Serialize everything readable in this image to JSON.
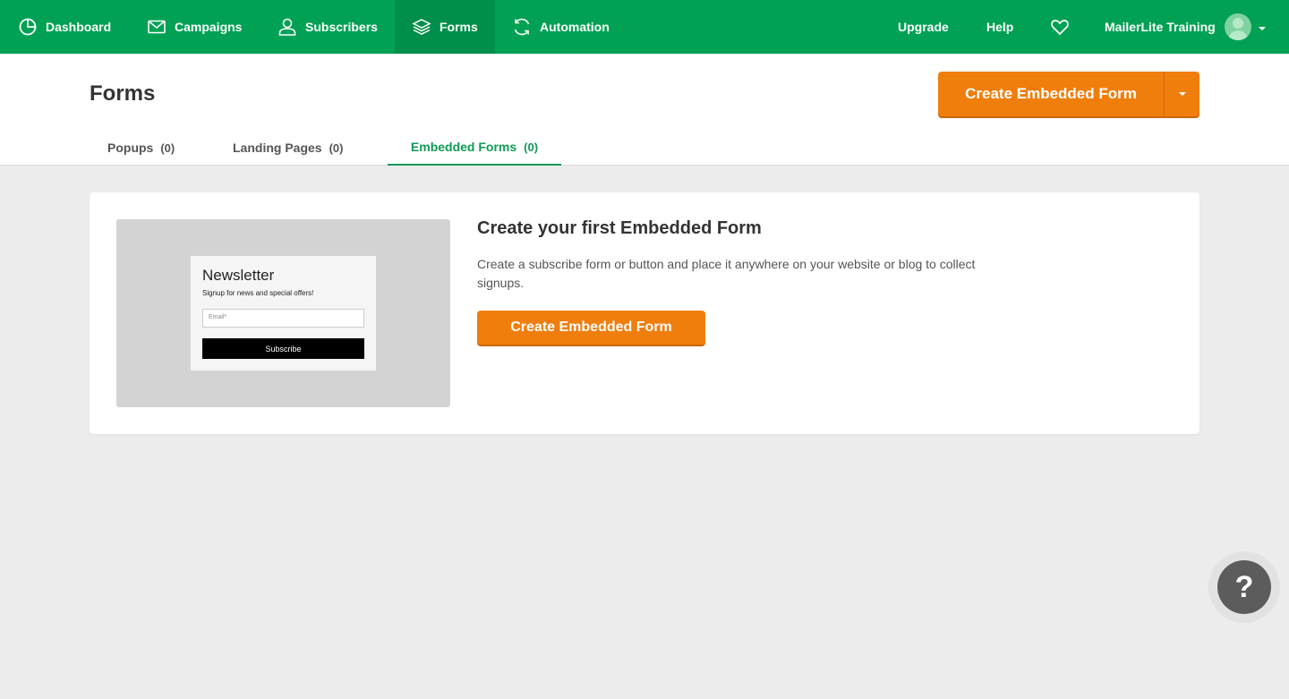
{
  "nav": {
    "dashboard": "Dashboard",
    "campaigns": "Campaigns",
    "subscribers": "Subscribers",
    "forms": "Forms",
    "automation": "Automation",
    "upgrade": "Upgrade",
    "help": "Help",
    "account": "MailerLite Training"
  },
  "header": {
    "title": "Forms",
    "create_button": "Create Embedded Form"
  },
  "tabs": [
    {
      "label": "Popups",
      "count": "(0)"
    },
    {
      "label": "Landing Pages",
      "count": "(0)"
    },
    {
      "label": "Embedded Forms",
      "count": "(0)"
    }
  ],
  "empty_state": {
    "title": "Create your first Embedded Form",
    "description": "Create a subscribe form or button and place it anywhere on your website or blog to collect signups.",
    "button": "Create Embedded Form",
    "preview": {
      "title": "Newsletter",
      "subtitle": "Signup for news and special offers!",
      "email_placeholder": "Email*",
      "subscribe": "Subscribe"
    }
  },
  "help_bubble": "?",
  "colors": {
    "brand_green": "#00a154",
    "accent_orange": "#f07e0c",
    "active_tab": "#0e9a55"
  },
  "icons": [
    "dashboard-icon",
    "campaigns-icon",
    "subscribers-icon",
    "forms-icon",
    "automation-icon",
    "heart-icon",
    "avatar",
    "caret-down-icon",
    "help-icon"
  ]
}
